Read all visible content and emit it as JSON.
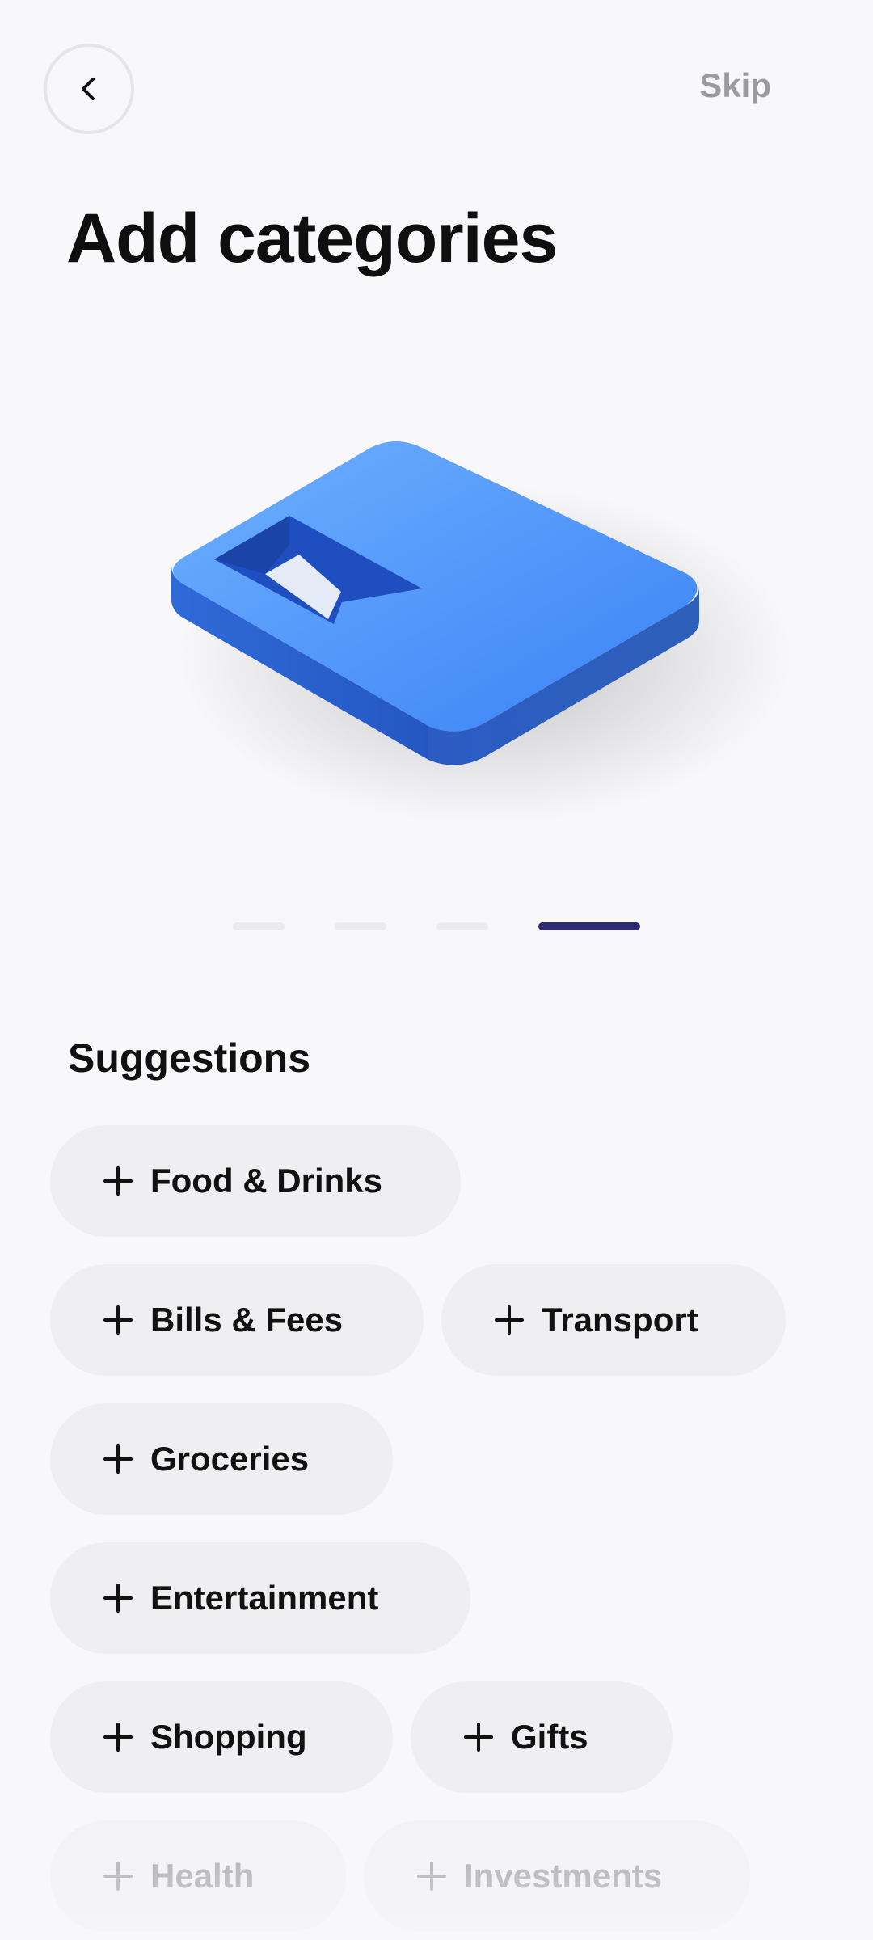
{
  "header": {
    "back_icon": "chevron-left-icon",
    "skip_label": "Skip"
  },
  "page": {
    "title": "Add categories"
  },
  "carousel": {
    "total_pages": 4,
    "active_page": 4,
    "illustration": "blue-wallet-card-3d-icon",
    "accent_color": "#2e2a78"
  },
  "suggestions": {
    "title": "Suggestions",
    "items": [
      {
        "label": "Food & Drinks"
      },
      {
        "label": "Bills & Fees"
      },
      {
        "label": "Transport"
      },
      {
        "label": "Groceries"
      },
      {
        "label": "Entertainment"
      },
      {
        "label": "Shopping"
      },
      {
        "label": "Gifts"
      },
      {
        "label": "Health"
      },
      {
        "label": "Investments"
      }
    ]
  }
}
